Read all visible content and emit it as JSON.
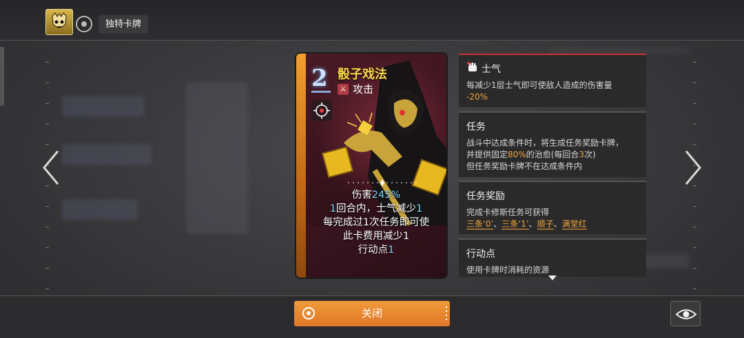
{
  "header": {
    "tag_label": "独特卡牌"
  },
  "card": {
    "cost": "2",
    "title": "骰子戏法",
    "type_label": "攻击",
    "desc_line1_a": "伤害",
    "desc_line1_b": "245%",
    "desc_line2_a": "1",
    "desc_line2_b": "回合内，士气减少",
    "desc_line2_c": "1",
    "desc_line3": "每完成过1次任务即可使",
    "desc_line4": "此卡费用减少1",
    "desc_line5_a": "行动点",
    "desc_line5_b": "1"
  },
  "info": {
    "morale": {
      "title": "士气",
      "text": "每减少1层士气即可使敌人造成的伤害量",
      "value": "-20%"
    },
    "mission": {
      "title": "任务",
      "line1": "战斗中达成条件时，将生成任务奖励卡牌，",
      "line2_a": "并提供固定",
      "line2_b": "80%",
      "line2_c": "的治愈(每回合",
      "line2_d": "3",
      "line2_e": "次)",
      "line3": "但任务奖励卡牌不在达成条件内"
    },
    "reward": {
      "title": "任务奖励",
      "line1": "完成卡修斯任务可获得",
      "link1": "三条‘0’",
      "link2": "三条‘1’",
      "link3": "顺子",
      "link4": "满堂红",
      "sep": "、"
    },
    "action": {
      "title": "行动点",
      "text": "使用卡牌时消耗的资源"
    }
  },
  "footer": {
    "close_label": "关闭"
  },
  "colors": {
    "accent": "#f0a53a",
    "button": "#e8862f",
    "highlight": "#7fd6ff"
  }
}
